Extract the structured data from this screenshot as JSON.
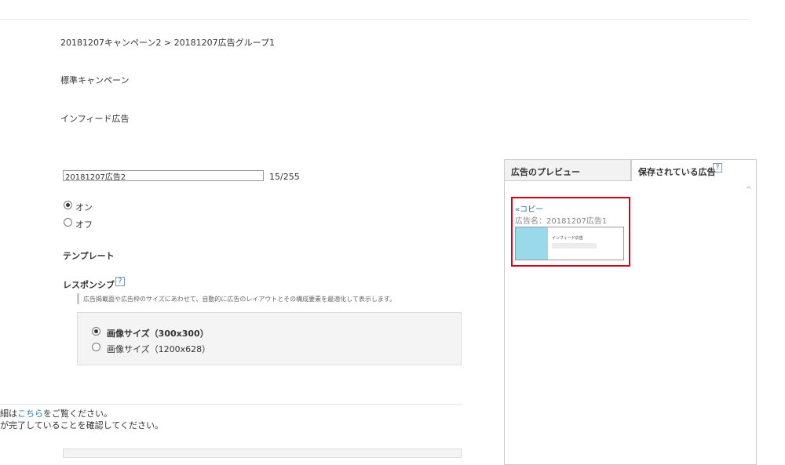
{
  "breadcrumb": "20181207キャンペーン2 > 20181207広告グループ1",
  "campaign_type": "標準キャンペーン",
  "ad_format": "インフィード広告",
  "ad_name": {
    "value": "20181207広告2",
    "counter": "15/255"
  },
  "status": {
    "on_label": "オン",
    "off_label": "オフ",
    "selected": "on"
  },
  "template_label": "テンプレート",
  "responsive": {
    "label": "レスポンシブ",
    "help": "?",
    "hint": "広告掲載面や広告枠のサイズにあわせて、自動的に広告のレイアウトとその構成要素を最適化して表示します。"
  },
  "image_sizes": [
    {
      "label": "画像サイズ（300x300）",
      "selected": true
    },
    {
      "label": "画像サイズ（1200x628）",
      "selected": false
    }
  ],
  "notice": {
    "line1_prefix": "細は",
    "line1_link": "こちら",
    "line1_suffix": "をご覧ください。",
    "line2": "が完了していることを確認してください。"
  },
  "preview_panel": {
    "tabs": [
      {
        "label": "広告のプレビュー",
        "active": false
      },
      {
        "label": "保存されている広告",
        "active": true
      }
    ],
    "help": "?",
    "saved_ad": {
      "copy_link": "«コピー",
      "name_label": "広告名：20181207広告1",
      "thumb_title": "インフィード広告"
    }
  },
  "colors": {
    "accent_red": "#d0021b",
    "link": "#2b7bb9",
    "thumb": "#99d9ea"
  }
}
